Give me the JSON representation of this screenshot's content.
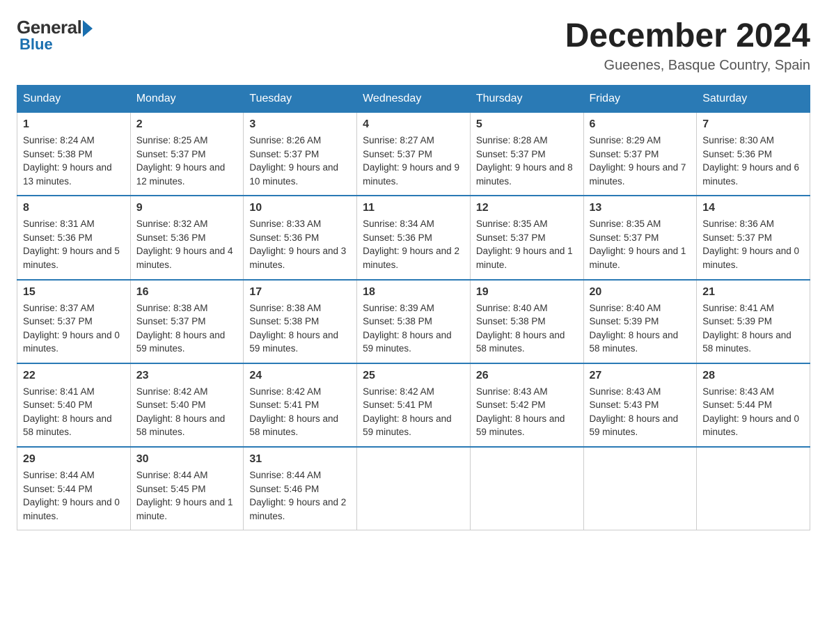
{
  "logo": {
    "general": "General",
    "blue": "Blue"
  },
  "title": "December 2024",
  "subtitle": "Gueenes, Basque Country, Spain",
  "days_of_week": [
    "Sunday",
    "Monday",
    "Tuesday",
    "Wednesday",
    "Thursday",
    "Friday",
    "Saturday"
  ],
  "weeks": [
    [
      {
        "day": "1",
        "sunrise": "8:24 AM",
        "sunset": "5:38 PM",
        "daylight": "9 hours and 13 minutes."
      },
      {
        "day": "2",
        "sunrise": "8:25 AM",
        "sunset": "5:37 PM",
        "daylight": "9 hours and 12 minutes."
      },
      {
        "day": "3",
        "sunrise": "8:26 AM",
        "sunset": "5:37 PM",
        "daylight": "9 hours and 10 minutes."
      },
      {
        "day": "4",
        "sunrise": "8:27 AM",
        "sunset": "5:37 PM",
        "daylight": "9 hours and 9 minutes."
      },
      {
        "day": "5",
        "sunrise": "8:28 AM",
        "sunset": "5:37 PM",
        "daylight": "9 hours and 8 minutes."
      },
      {
        "day": "6",
        "sunrise": "8:29 AM",
        "sunset": "5:37 PM",
        "daylight": "9 hours and 7 minutes."
      },
      {
        "day": "7",
        "sunrise": "8:30 AM",
        "sunset": "5:36 PM",
        "daylight": "9 hours and 6 minutes."
      }
    ],
    [
      {
        "day": "8",
        "sunrise": "8:31 AM",
        "sunset": "5:36 PM",
        "daylight": "9 hours and 5 minutes."
      },
      {
        "day": "9",
        "sunrise": "8:32 AM",
        "sunset": "5:36 PM",
        "daylight": "9 hours and 4 minutes."
      },
      {
        "day": "10",
        "sunrise": "8:33 AM",
        "sunset": "5:36 PM",
        "daylight": "9 hours and 3 minutes."
      },
      {
        "day": "11",
        "sunrise": "8:34 AM",
        "sunset": "5:36 PM",
        "daylight": "9 hours and 2 minutes."
      },
      {
        "day": "12",
        "sunrise": "8:35 AM",
        "sunset": "5:37 PM",
        "daylight": "9 hours and 1 minute."
      },
      {
        "day": "13",
        "sunrise": "8:35 AM",
        "sunset": "5:37 PM",
        "daylight": "9 hours and 1 minute."
      },
      {
        "day": "14",
        "sunrise": "8:36 AM",
        "sunset": "5:37 PM",
        "daylight": "9 hours and 0 minutes."
      }
    ],
    [
      {
        "day": "15",
        "sunrise": "8:37 AM",
        "sunset": "5:37 PM",
        "daylight": "9 hours and 0 minutes."
      },
      {
        "day": "16",
        "sunrise": "8:38 AM",
        "sunset": "5:37 PM",
        "daylight": "8 hours and 59 minutes."
      },
      {
        "day": "17",
        "sunrise": "8:38 AM",
        "sunset": "5:38 PM",
        "daylight": "8 hours and 59 minutes."
      },
      {
        "day": "18",
        "sunrise": "8:39 AM",
        "sunset": "5:38 PM",
        "daylight": "8 hours and 59 minutes."
      },
      {
        "day": "19",
        "sunrise": "8:40 AM",
        "sunset": "5:38 PM",
        "daylight": "8 hours and 58 minutes."
      },
      {
        "day": "20",
        "sunrise": "8:40 AM",
        "sunset": "5:39 PM",
        "daylight": "8 hours and 58 minutes."
      },
      {
        "day": "21",
        "sunrise": "8:41 AM",
        "sunset": "5:39 PM",
        "daylight": "8 hours and 58 minutes."
      }
    ],
    [
      {
        "day": "22",
        "sunrise": "8:41 AM",
        "sunset": "5:40 PM",
        "daylight": "8 hours and 58 minutes."
      },
      {
        "day": "23",
        "sunrise": "8:42 AM",
        "sunset": "5:40 PM",
        "daylight": "8 hours and 58 minutes."
      },
      {
        "day": "24",
        "sunrise": "8:42 AM",
        "sunset": "5:41 PM",
        "daylight": "8 hours and 58 minutes."
      },
      {
        "day": "25",
        "sunrise": "8:42 AM",
        "sunset": "5:41 PM",
        "daylight": "8 hours and 59 minutes."
      },
      {
        "day": "26",
        "sunrise": "8:43 AM",
        "sunset": "5:42 PM",
        "daylight": "8 hours and 59 minutes."
      },
      {
        "day": "27",
        "sunrise": "8:43 AM",
        "sunset": "5:43 PM",
        "daylight": "8 hours and 59 minutes."
      },
      {
        "day": "28",
        "sunrise": "8:43 AM",
        "sunset": "5:44 PM",
        "daylight": "9 hours and 0 minutes."
      }
    ],
    [
      {
        "day": "29",
        "sunrise": "8:44 AM",
        "sunset": "5:44 PM",
        "daylight": "9 hours and 0 minutes."
      },
      {
        "day": "30",
        "sunrise": "8:44 AM",
        "sunset": "5:45 PM",
        "daylight": "9 hours and 1 minute."
      },
      {
        "day": "31",
        "sunrise": "8:44 AM",
        "sunset": "5:46 PM",
        "daylight": "9 hours and 2 minutes."
      },
      null,
      null,
      null,
      null
    ]
  ],
  "labels": {
    "sunrise": "Sunrise:",
    "sunset": "Sunset:",
    "daylight": "Daylight:"
  }
}
